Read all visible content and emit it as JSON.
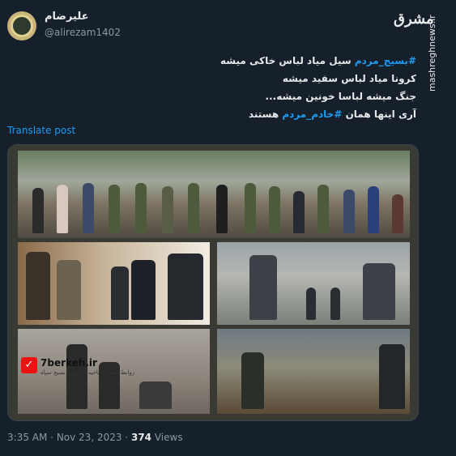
{
  "author": {
    "display_name": "علیرضام",
    "handle": "@alirezam1402"
  },
  "watermark": {
    "logo_text": "مشرق",
    "site": "mashreghnews.ir"
  },
  "tweet": {
    "line1_tag": "#بسیج_مردم",
    "line1_text": "سیل میاد لباس خاکی میشه",
    "line2": "کرونا میاد لباس سفید میشه",
    "line3": "جنگ میشه لباسا خونین میشه...",
    "line4_pre": "آری اینها همان",
    "line4_tag": "#خادم_مردم",
    "line4_post": "هستند"
  },
  "translate_label": "Translate post",
  "media": {
    "badge_site": "7berkeh.ir",
    "badge_caption": "روابط عمومی ناحیه مقاومت بسیج سپاه"
  },
  "meta": {
    "time": "3:35 AM",
    "separator": "·",
    "date": "Nov 23, 2023",
    "views_count": "374",
    "views_label": "Views"
  }
}
